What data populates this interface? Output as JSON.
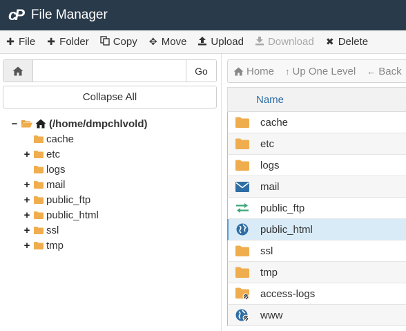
{
  "header": {
    "logo_text": "cP",
    "title": "File Manager"
  },
  "toolbar": {
    "file": "File",
    "folder": "Folder",
    "copy": "Copy",
    "move": "Move",
    "upload": "Upload",
    "download": "Download",
    "delete": "Delete"
  },
  "left": {
    "path_value": "",
    "go_label": "Go",
    "collapse_label": "Collapse All",
    "tree": {
      "root": "(/home/dmpchlvold)",
      "items": [
        {
          "label": "cache",
          "expandable": false
        },
        {
          "label": "etc",
          "expandable": true
        },
        {
          "label": "logs",
          "expandable": false
        },
        {
          "label": "mail",
          "expandable": true
        },
        {
          "label": "public_ftp",
          "expandable": true
        },
        {
          "label": "public_html",
          "expandable": true
        },
        {
          "label": "ssl",
          "expandable": true
        },
        {
          "label": "tmp",
          "expandable": true
        }
      ]
    }
  },
  "nav": {
    "home": "Home",
    "up": "Up One Level",
    "back": "Back"
  },
  "table": {
    "name_header": "Name",
    "rows": [
      {
        "name": "cache",
        "icon": "folder-icon"
      },
      {
        "name": "etc",
        "icon": "folder-icon"
      },
      {
        "name": "logs",
        "icon": "folder-icon"
      },
      {
        "name": "mail",
        "icon": "envelope-icon"
      },
      {
        "name": "public_ftp",
        "icon": "exchange-icon"
      },
      {
        "name": "public_html",
        "icon": "globe-icon"
      },
      {
        "name": "ssl",
        "icon": "folder-icon"
      },
      {
        "name": "tmp",
        "icon": "folder-icon"
      },
      {
        "name": "access-logs",
        "icon": "folder-link-icon"
      },
      {
        "name": "www",
        "icon": "globe-link-icon"
      }
    ]
  },
  "colors": {
    "header_bg": "#293a4a",
    "folder": "#f0ad4e",
    "accent": "#2f6ea5",
    "selected_row": "#d9ebf7"
  }
}
